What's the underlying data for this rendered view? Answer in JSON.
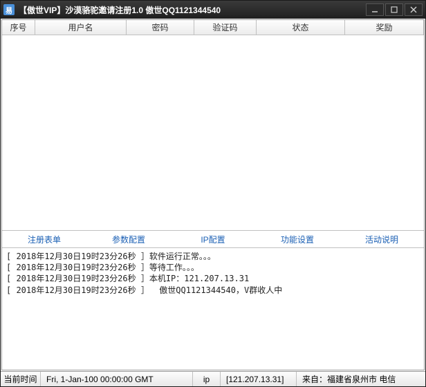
{
  "titlebar": {
    "icon_text": "易",
    "title": "【傲世VIP】沙漠骆驼邀请注册1.0 傲世QQ1121344540"
  },
  "grid": {
    "headers": {
      "seq": "序号",
      "user": "用户名",
      "pass": "密码",
      "code": "验证码",
      "status": "状态",
      "reward": "奖励"
    }
  },
  "tabs": {
    "t0": "注册表单",
    "t1": "参数配置",
    "t2": "IP配置",
    "t3": "功能设置",
    "t4": "活动说明"
  },
  "log": {
    "l0": "[ 2018年12月30日19时23分26秒 ］软件运行正常。。。",
    "l1": "[ 2018年12月30日19时23分26秒 ］等待工作。。。",
    "l2": "[ 2018年12月30日19时23分26秒 ］本机IP：121.207.13.31",
    "l3": "[ 2018年12月30日19时23分26秒 ］  傲世QQ1121344540，V群收人中"
  },
  "status": {
    "time_label": "当前时间",
    "time_value": "Fri, 1-Jan-100 00:00:00 GMT",
    "ip_label": "ip",
    "ip_value": "[121.207.13.31]",
    "from_value": "来自：福建省泉州市 电信"
  }
}
